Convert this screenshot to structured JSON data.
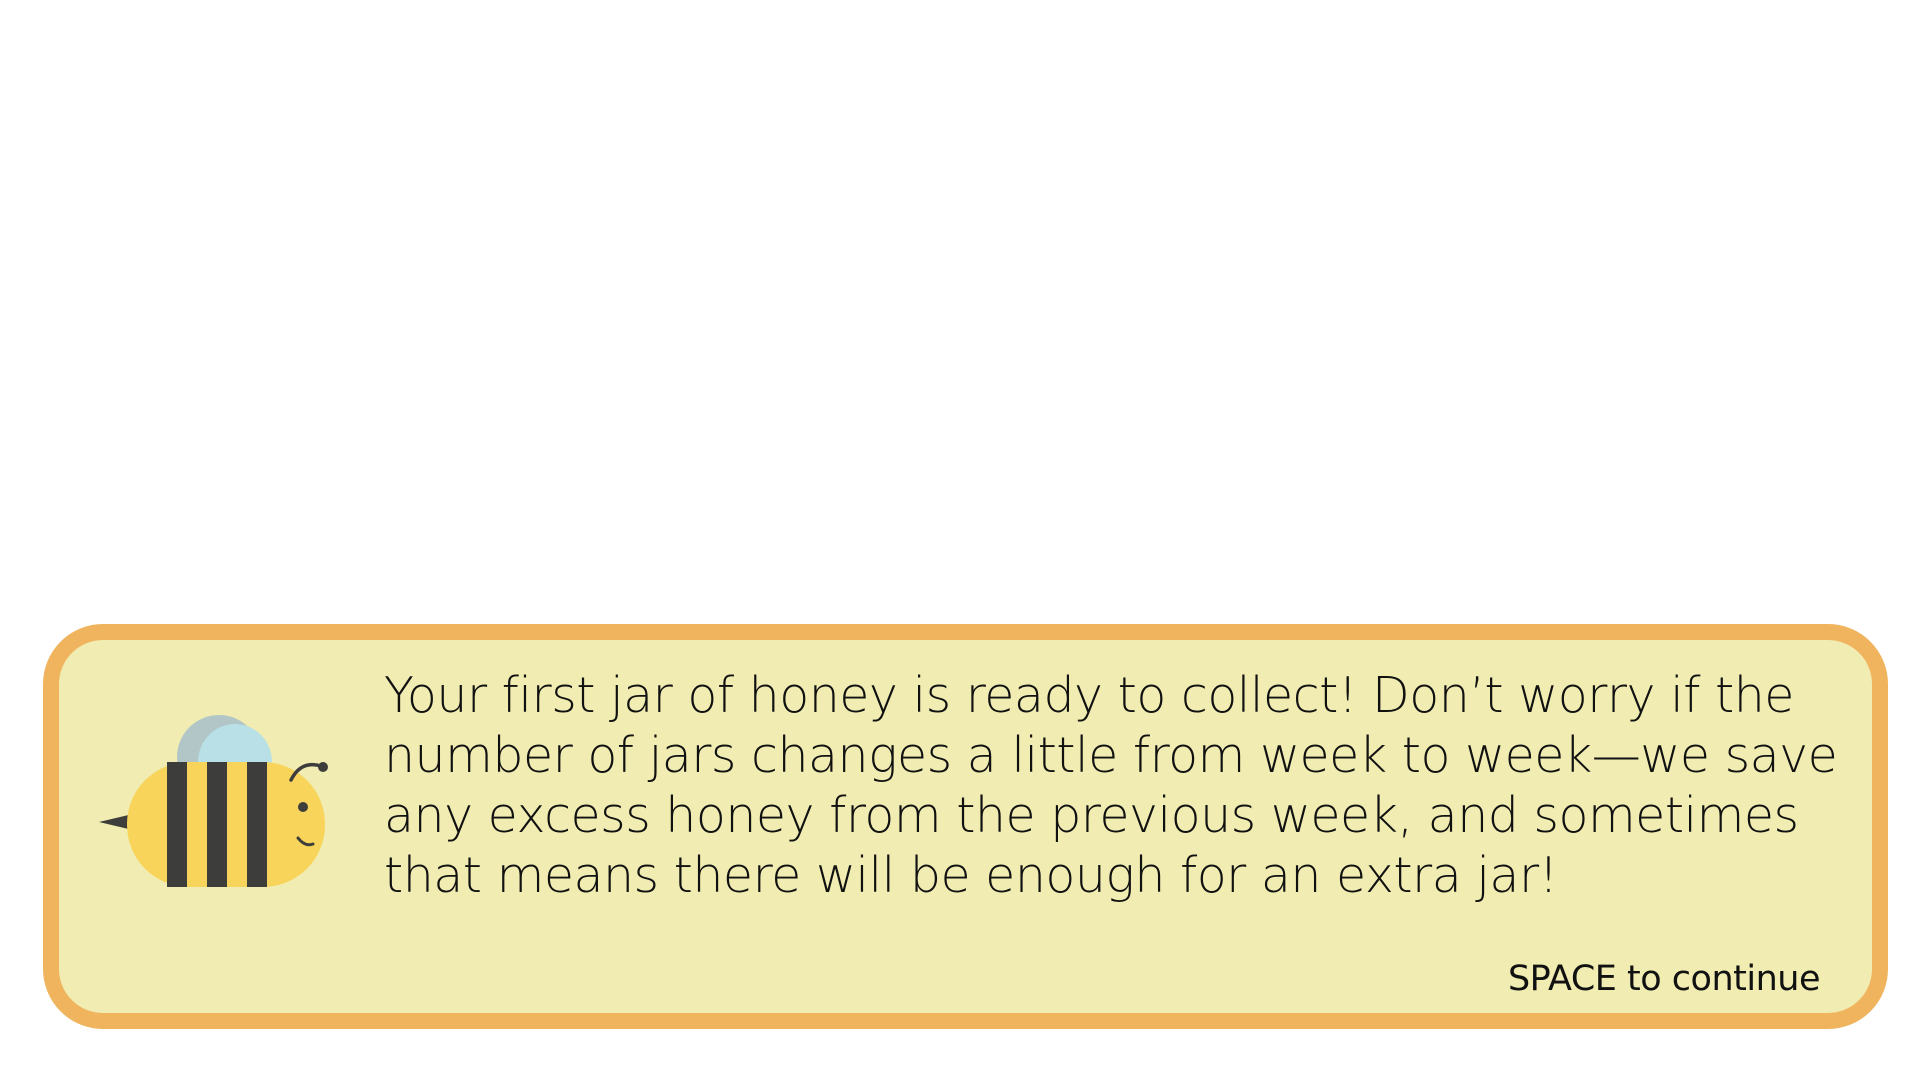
{
  "dialog": {
    "message": "Your first jar of honey is ready to collect! Don’t worry if the number of jars changes a little from week to week—we save any excess honey from the previous week, and sometimes that means there will be enough for an extra jar!",
    "continue_hint": "SPACE to continue",
    "character_icon": "bee-icon"
  },
  "colors": {
    "dialog_border": "#f0b45e",
    "dialog_fill": "#f0ecb2",
    "bee_yellow": "#f8d55a",
    "bee_stripes": "#3d3d3b",
    "bee_wings": "#b8e0e6"
  }
}
